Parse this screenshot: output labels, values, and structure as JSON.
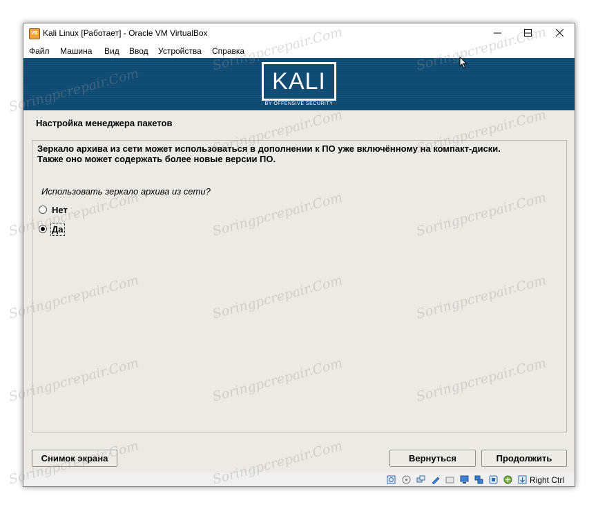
{
  "window": {
    "title": "Kali Linux [Работает] - Oracle VM VirtualBox",
    "app_icon": "virtualbox-icon",
    "controls": [
      "minimize-icon",
      "maximize-icon",
      "close-icon"
    ]
  },
  "menu": [
    "Файл",
    "Машина",
    "Вид",
    "Ввод",
    "Устройства",
    "Справка"
  ],
  "banner": {
    "logo_text": "KALI",
    "tagline": "BY OFFENSIVE SECURITY"
  },
  "installer": {
    "step_title": "Настройка менеджера пакетов",
    "description_line1": "Зеркало архива из сети может использоваться в дополнении к ПО уже включённому на компакт-диски.",
    "description_line2": "Также оно может содержать более новые версии ПО.",
    "question": "Использовать зеркало архива из сети?",
    "options": [
      {
        "label": "Нет",
        "selected": false
      },
      {
        "label": "Да",
        "selected": true
      }
    ],
    "buttons": {
      "screenshot": "Снимок экрана",
      "back": "Вернуться",
      "continue": "Продолжить"
    }
  },
  "statusbar": {
    "icons": [
      "hard-disk-icon",
      "optical-drive-icon",
      "audio-icon",
      "network-icon",
      "shared-folders-icon",
      "display-icon",
      "usb-icon",
      "video-capture-icon",
      "cpu-icon",
      "mouse-integration-icon",
      "keyboard-capture-icon"
    ],
    "host_key": "Right Ctrl"
  },
  "watermark": "Soringpcrepair.Com"
}
